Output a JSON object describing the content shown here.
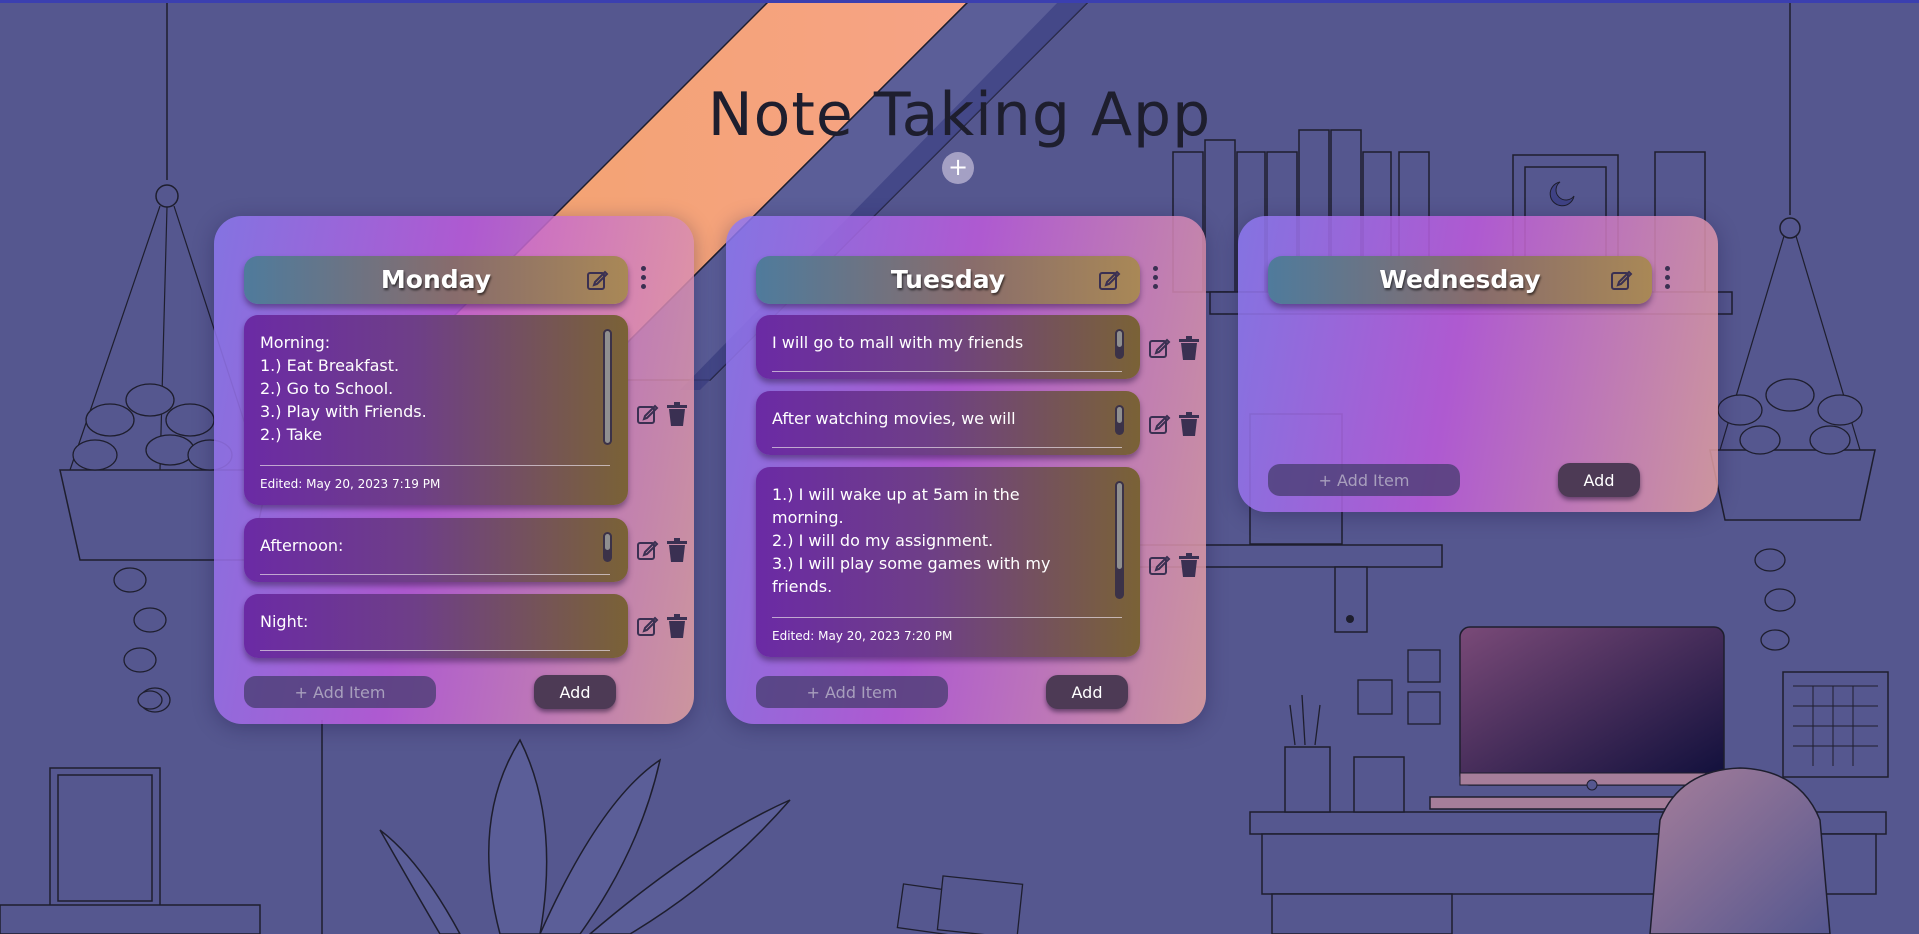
{
  "app": {
    "title": "Note Taking App"
  },
  "colors": {
    "accent": "#a64fd6",
    "header_start": "#4f7b9c",
    "header_end": "#a98856",
    "note_start": "#6b2aa5",
    "note_end": "#7a6236"
  },
  "boards": [
    {
      "name": "Monday",
      "add_placeholder": "+ Add Item",
      "add_label": "Add",
      "notes": [
        {
          "text": "Morning:\n1.) Eat Breakfast.\n2.) Go to School.\n3.) Play with Friends.\n2.) Take",
          "edited": "Edited: May 20, 2023 7:19 PM"
        },
        {
          "text": "Afternoon:",
          "edited": ""
        },
        {
          "text": "Night:",
          "edited": ""
        }
      ]
    },
    {
      "name": "Tuesday",
      "add_placeholder": "+ Add Item",
      "add_label": "Add",
      "notes": [
        {
          "text": "I will go to mall with my friends",
          "edited": ""
        },
        {
          "text": "After watching movies, we will",
          "edited": ""
        },
        {
          "text": "1.) I will wake up at 5am in the morning.\n2.) I will do my assignment.\n3.) I will play some games with my friends.",
          "edited": "Edited: May 20, 2023 7:20 PM"
        }
      ]
    },
    {
      "name": "Wednesday",
      "add_placeholder": "+ Add Item",
      "add_label": "Add",
      "notes": []
    }
  ],
  "icons": {
    "add_board": "plus-icon",
    "edit": "pencil-square-icon",
    "delete": "trash-icon",
    "menu": "kebab-menu-icon"
  }
}
